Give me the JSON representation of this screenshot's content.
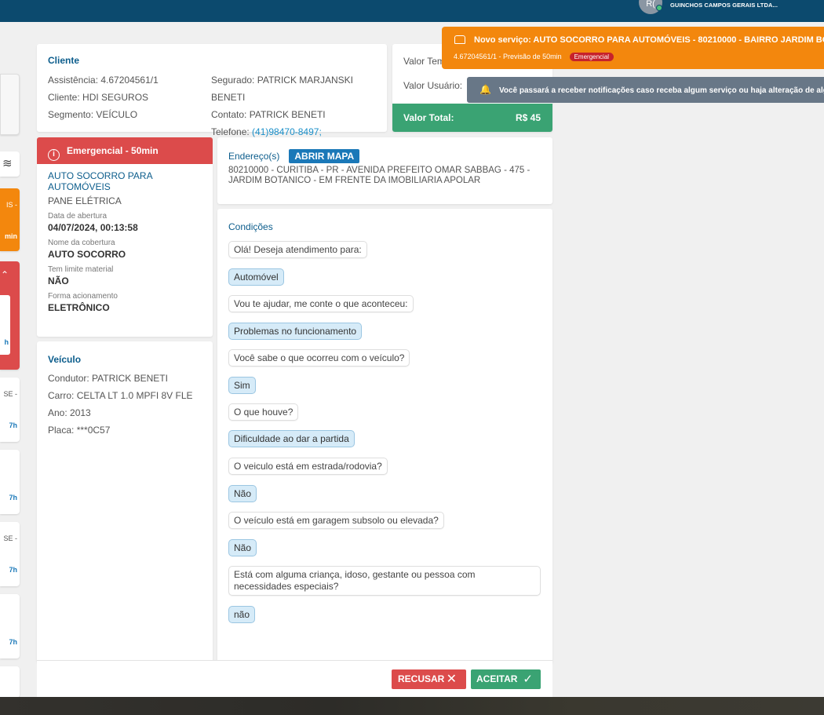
{
  "header": {
    "avatar_initials": "R(",
    "company": "GUINCHOS CAMPOS GERAIS LTDA..."
  },
  "left_strip": {
    "items": [
      {
        "text": "IS -"
      },
      {
        "text": "min"
      },
      {
        "text": "h"
      },
      {
        "text": "SE -"
      },
      {
        "text": "7h"
      },
      {
        "text": "7h"
      },
      {
        "text": "SE -"
      },
      {
        "text": "7h"
      },
      {
        "text": "7h"
      }
    ]
  },
  "cliente": {
    "title": "Cliente",
    "assistencia_label": "Assistência:",
    "assistencia": "4.67204561/1",
    "cliente_label": "Cliente:",
    "cliente": "HDI SEGUROS",
    "segmento_label": "Segmento:",
    "segmento": "VEÍCULO",
    "segurado_label": "Segurado:",
    "segurado": "PATRICK MARJANSKI BENETI",
    "contato_label": "Contato:",
    "contato": "PATRICK BENETI",
    "telefone_label": "Telefone:",
    "telefone": "(41)98470-8497;"
  },
  "valores": {
    "tempo_label": "Valor Tem",
    "usuario_label": "Valor Usuário:",
    "total_label": "Valor Total:",
    "total_value": "R$ 45"
  },
  "servico": {
    "header": "Emergencial - 50min",
    "name": "AUTO SOCORRO PARA AUTOMÓVEIS",
    "problem": "PANE ELÉTRICA",
    "data_label": "Data de abertura",
    "data_value": "04/07/2024, 00:13:58",
    "cobertura_label": "Nome da cobertura",
    "cobertura_value": "AUTO SOCORRO",
    "limite_label": "Tem limite material",
    "limite_value": "NÃO",
    "forma_label": "Forma acionamento",
    "forma_value": "ELETRÔNICO"
  },
  "veiculo": {
    "title": "Veículo",
    "condutor_label": "Condutor:",
    "condutor": "PATRICK BENETI",
    "carro_label": "Carro:",
    "carro": "CELTA LT 1.0 MPFI 8V FLE",
    "ano_label": "Ano:",
    "ano": "2013",
    "placa_label": "Placa:",
    "placa": "***0C57"
  },
  "endereco": {
    "title": "Endereço(s)",
    "map_button": "ABRIR MAPA",
    "line1": "80210000 - CURITIBA - PR - AVENIDA PREFEITO OMAR SABBAG - 475 -",
    "line2": "JARDIM BOTANICO - EM FRENTE DA IMOBILIARIA APOLAR"
  },
  "condicoes": {
    "title": "Condições",
    "messages": [
      {
        "type": "q",
        "text": "Olá! Deseja atendimento para:"
      },
      {
        "type": "a",
        "text": "Automóvel"
      },
      {
        "type": "q",
        "text": "Vou te ajudar, me conte o que aconteceu:"
      },
      {
        "type": "a",
        "text": "Problemas no funcionamento"
      },
      {
        "type": "q",
        "text": "Você sabe o que ocorreu com o veículo?"
      },
      {
        "type": "a",
        "text": "Sim"
      },
      {
        "type": "q",
        "text": "O que houve?"
      },
      {
        "type": "a",
        "text": "Dificuldade ao dar a partida"
      },
      {
        "type": "q",
        "text": "O veiculo está em estrada/rodovia?"
      },
      {
        "type": "a",
        "text": "Não"
      },
      {
        "type": "q",
        "text": "O veículo está em garagem subsolo ou elevada?"
      },
      {
        "type": "a",
        "text": "Não"
      },
      {
        "type": "q",
        "text": "Está com alguma criança, idoso, gestante ou pessoa com necessidades especiais?"
      },
      {
        "type": "a",
        "text": "não"
      }
    ]
  },
  "actions": {
    "recusar": "RECUSAR",
    "aceitar": "ACEITAR"
  },
  "toast": {
    "title": "Novo serviço: AUTO SOCORRO PARA AUTOMÓVEIS - 80210000 - BAIRRO JARDIM BO",
    "subtitle": "4.67204561/1 - Previsão de 50min",
    "badge": "Emergencial",
    "notification": "Você passará a receber notificações caso receba algum serviço ou haja alteração de algum"
  },
  "colors": {
    "topbar": "#0c4a6e",
    "emergencial": "#dc4b4b",
    "total": "#3aa373",
    "toast": "#f3870d"
  }
}
